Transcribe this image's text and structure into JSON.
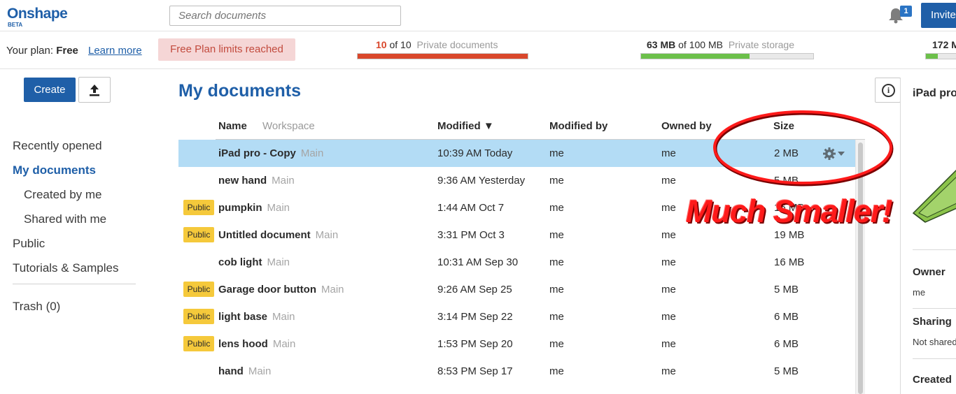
{
  "app": {
    "logo": "Onshape",
    "beta": "BETA",
    "search_placeholder": "Search documents",
    "notifications_count": "1",
    "invite_label": "Invite"
  },
  "plan": {
    "label": "Your plan:",
    "plan_name": "Free",
    "learn_more": "Learn more",
    "limits_notice": "Free Plan limits reached",
    "docs_used": "10",
    "docs_of": "of 10",
    "docs_label": "Private documents",
    "docs_fraction": 1.0,
    "storage_used": "63 MB",
    "storage_of": "of 100 MB",
    "storage_label": "Private storage",
    "storage_fraction": 0.63,
    "third_meter_value": "172 M",
    "third_meter_fraction": 0.3
  },
  "sidebar": {
    "create_label": "Create",
    "upload_icon": "upload-icon",
    "items": [
      {
        "label": "Recently opened",
        "active": false,
        "sub": false
      },
      {
        "label": "My documents",
        "active": true,
        "sub": false
      },
      {
        "label": "Created by me",
        "active": false,
        "sub": true
      },
      {
        "label": "Shared with me",
        "active": false,
        "sub": true
      },
      {
        "label": "Public",
        "active": false,
        "sub": false
      },
      {
        "label": "Tutorials & Samples",
        "active": false,
        "sub": false
      }
    ],
    "trash_label": "Trash",
    "trash_count": "(0)"
  },
  "main": {
    "title": "My documents",
    "columns": {
      "name": "Name",
      "workspace": "Workspace",
      "modified": "Modified ▼",
      "modified_by": "Modified by",
      "owned_by": "Owned by",
      "size": "Size"
    },
    "rows": [
      {
        "name": "iPad pro - Copy",
        "workspace": "Main",
        "modified": "10:39 AM Today",
        "modified_by": "me",
        "owned_by": "me",
        "size": "2 MB",
        "public": false,
        "selected": true
      },
      {
        "name": "new hand",
        "workspace": "Main",
        "modified": "9:36 AM Yesterday",
        "modified_by": "me",
        "owned_by": "me",
        "size": "5 MB",
        "public": false,
        "selected": false
      },
      {
        "name": "pumpkin",
        "workspace": "Main",
        "modified": "1:44 AM Oct 7",
        "modified_by": "me",
        "owned_by": "me",
        "size": "16 MB",
        "public": true,
        "selected": false
      },
      {
        "name": "Untitled document",
        "workspace": "Main",
        "modified": "3:31 PM Oct 3",
        "modified_by": "me",
        "owned_by": "me",
        "size": "19 MB",
        "public": true,
        "selected": false
      },
      {
        "name": "cob light",
        "workspace": "Main",
        "modified": "10:31 AM Sep 30",
        "modified_by": "me",
        "owned_by": "me",
        "size": "16 MB",
        "public": false,
        "selected": false
      },
      {
        "name": "Garage door button",
        "workspace": "Main",
        "modified": "9:26 AM Sep 25",
        "modified_by": "me",
        "owned_by": "me",
        "size": "5 MB",
        "public": true,
        "selected": false
      },
      {
        "name": "light base",
        "workspace": "Main",
        "modified": "3:14 PM Sep 22",
        "modified_by": "me",
        "owned_by": "me",
        "size": "6 MB",
        "public": true,
        "selected": false
      },
      {
        "name": "lens hood",
        "workspace": "Main",
        "modified": "1:53 PM Sep 20",
        "modified_by": "me",
        "owned_by": "me",
        "size": "6 MB",
        "public": true,
        "selected": false
      },
      {
        "name": "hand",
        "workspace": "Main",
        "modified": "8:53 PM Sep 17",
        "modified_by": "me",
        "owned_by": "me",
        "size": "5 MB",
        "public": false,
        "selected": false
      }
    ],
    "public_badge": "Public"
  },
  "panel": {
    "title": "iPad pro",
    "owner_label": "Owner",
    "owner_value": "me",
    "sharing_label": "Sharing",
    "sharing_value": "Not shared",
    "created_label": "Created"
  },
  "annotation": {
    "text": "Much Smaller!",
    "color": "#ff1a1a"
  },
  "colors": {
    "brand": "#1f5fa8",
    "selected_row": "#b3dcf5",
    "public_badge": "#f5c93b",
    "meter_red": "#d9472b",
    "meter_green": "#6cc04a"
  }
}
